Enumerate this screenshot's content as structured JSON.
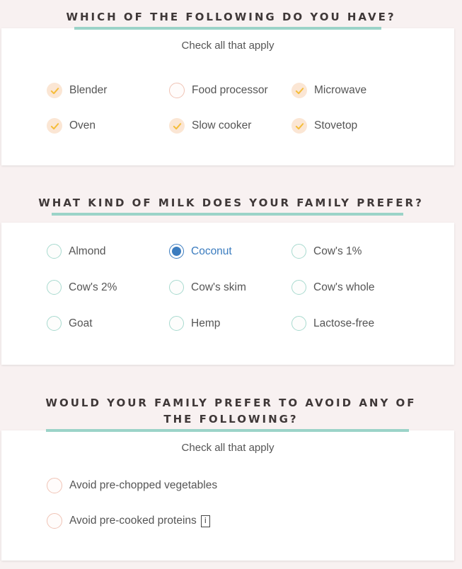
{
  "sections": [
    {
      "heading": "WHICH OF THE FOLLOWING DO YOU HAVE?",
      "subtitle": "Check all that apply",
      "type": "checkbox",
      "options": [
        {
          "label": "Blender",
          "checked": true
        },
        {
          "label": "Food processor",
          "checked": false
        },
        {
          "label": "Microwave",
          "checked": true
        },
        {
          "label": "Oven",
          "checked": true
        },
        {
          "label": "Slow cooker",
          "checked": true
        },
        {
          "label": "Stovetop",
          "checked": true
        }
      ]
    },
    {
      "heading": "WHAT KIND OF MILK DOES YOUR FAMILY PREFER?",
      "type": "radio",
      "selected": "Coconut",
      "options": [
        {
          "label": "Almond"
        },
        {
          "label": "Coconut"
        },
        {
          "label": "Cow's 1%"
        },
        {
          "label": "Cow's 2%"
        },
        {
          "label": "Cow's skim"
        },
        {
          "label": "Cow's whole"
        },
        {
          "label": "Goat"
        },
        {
          "label": "Hemp"
        },
        {
          "label": "Lactose-free"
        }
      ]
    },
    {
      "heading_line1": "WOULD YOUR FAMILY PREFER TO AVOID ANY OF",
      "heading_line2": "THE FOLLOWING?",
      "subtitle": "Check all that apply",
      "type": "checkbox",
      "options": [
        {
          "label": "Avoid pre-chopped vegetables",
          "checked": false
        },
        {
          "label": "Avoid pre-cooked proteins",
          "checked": false,
          "info_icon": "i"
        }
      ]
    }
  ],
  "colors": {
    "background": "#f8f1f1",
    "accent_underline": "#9bd3c8",
    "checkbox_fill": "#fbe6d4",
    "checkmark": "#f5bd3a",
    "radio_selected": "#3b7cbf"
  }
}
